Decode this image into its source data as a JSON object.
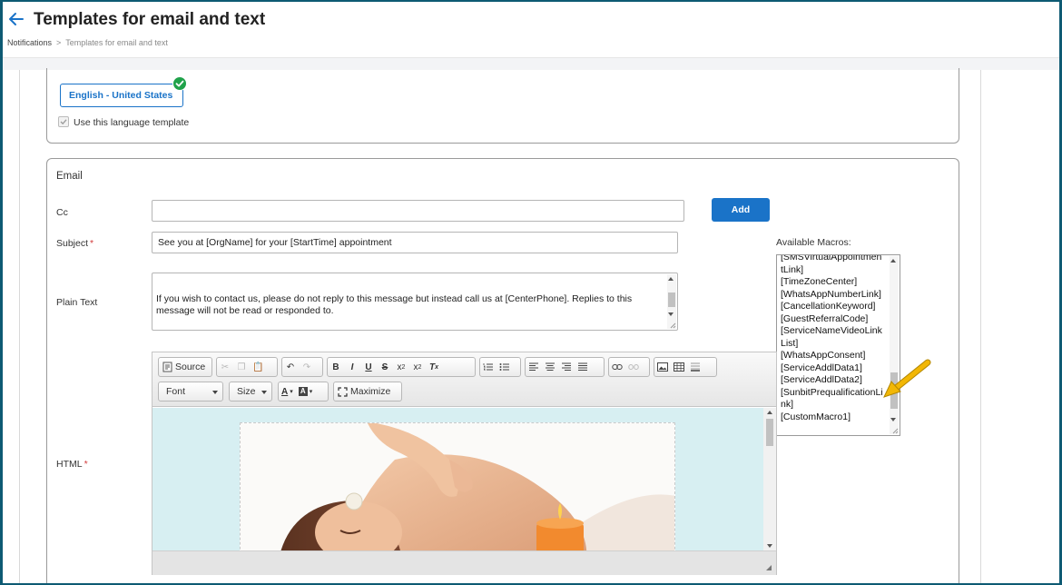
{
  "header": {
    "title": "Templates for email and text",
    "breadcrumb": [
      "Notifications",
      "Templates for email and text"
    ],
    "breadcrumb_separator": ">"
  },
  "language": {
    "selected": "English - United States",
    "use_template_label": "Use this language template",
    "use_template_checked": true
  },
  "email": {
    "section_title": "Email",
    "cc_label": "Cc",
    "cc_value": "",
    "add_label": "Add",
    "subject_label": "Subject",
    "subject_value": "See you at [OrgName] for your [StartTime] appointment",
    "plain_text_label": "Plain Text",
    "plain_text_value": "If you wish to contact us, please do not reply to this message but instead call us at [CenterPhone]. Replies to this message will not be read or responded to.",
    "html_label": "HTML",
    "available_macros_label": "Available Macros:",
    "macros": [
      "[SMSVirtualAppointmentLink]",
      "[TimeZoneCenter]",
      "[WhatsAppNumberLink]",
      "[CancellationKeyword]",
      "[GuestReferralCode]",
      "[ServiceNameVideoLinkList]",
      "[WhatsAppConsent]",
      "[ServiceAddlData1]",
      "[ServiceAddlData2]",
      "[SunbitPrequalificationLink]",
      "[CustomMacro1]"
    ]
  },
  "editor": {
    "source_label": "Source",
    "font_label": "Font",
    "size_label": "Size",
    "maximize_label": "Maximize"
  },
  "colors": {
    "accent": "#1a73c8",
    "required": "#d23b3b",
    "success": "#1fa24a",
    "editor_background": "#d7eff2",
    "pointer_arrow": "#f2b705"
  }
}
